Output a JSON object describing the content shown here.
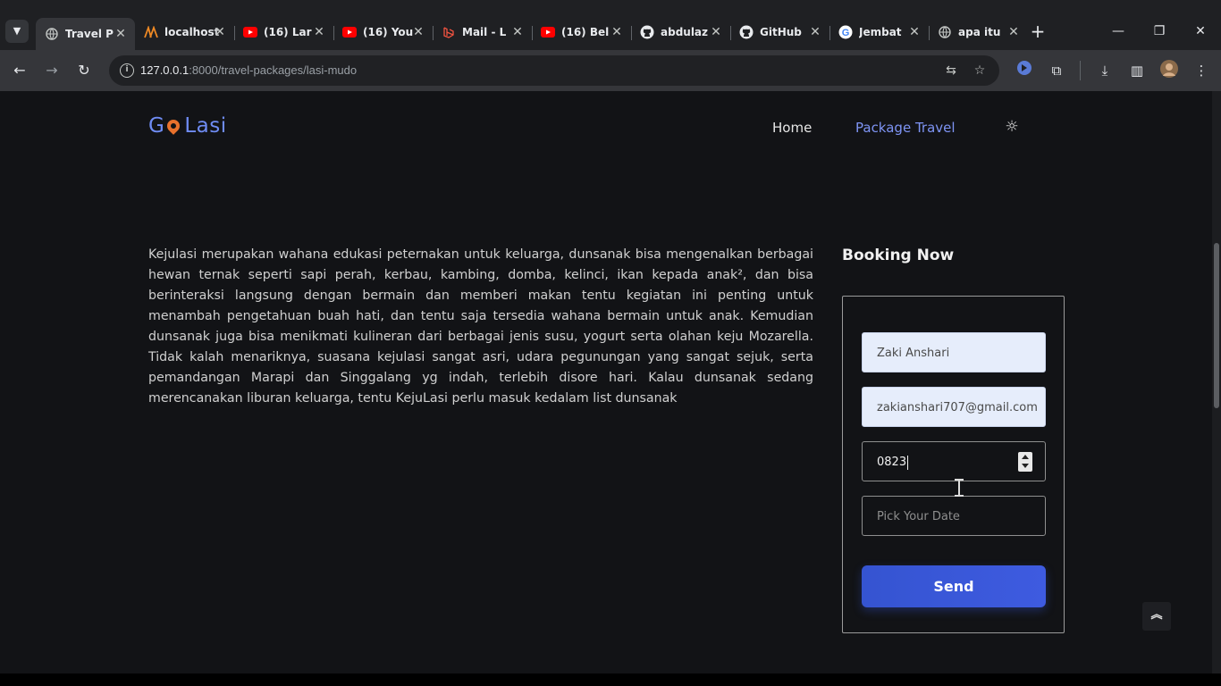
{
  "browser": {
    "tabs": [
      {
        "title": "Travel P",
        "favicon": "globe-icon",
        "active": true
      },
      {
        "title": "localhost",
        "favicon": "xampp-icon"
      },
      {
        "title": "(16) Lar",
        "favicon": "youtube-icon"
      },
      {
        "title": "(16) You",
        "favicon": "youtube-icon"
      },
      {
        "title": "Mail - L",
        "favicon": "laravel-icon"
      },
      {
        "title": "(16) Bel",
        "favicon": "youtube-icon"
      },
      {
        "title": "abdulaz",
        "favicon": "github-icon"
      },
      {
        "title": "GitHub",
        "favicon": "github-icon"
      },
      {
        "title": "Jembat",
        "favicon": "google-icon"
      },
      {
        "title": "apa itu",
        "favicon": "globe-icon"
      }
    ],
    "url_host": "127.0.0.1",
    "url_path": ":8000/travel-packages/lasi-mudo",
    "colors": {
      "accent": "#3554d1",
      "brand": "#6f8cf4",
      "pin": "#e8712c",
      "background": "#121316"
    }
  },
  "site": {
    "logo_prefix": "G",
    "logo_suffix": "Lasi",
    "nav": {
      "home": "Home",
      "package_travel": "Package Travel"
    },
    "description": "Kejulasi merupakan wahana edukasi peternakan untuk keluarga, dunsanak bisa mengenalkan berbagai hewan ternak seperti sapi perah, kerbau, kambing, domba, kelinci, ikan kepada anak², dan bisa berinteraksi langsung dengan bermain dan memberi makan tentu kegiatan ini penting untuk menambah pengetahuan buah hati, dan tentu saja tersedia wahana bermain untuk anak. Kemudian dunsanak juga bisa menikmati kulineran dari berbagai jenis susu, yogurt serta olahan keju Mozarella. Tidak kalah menariknya, suasana kejulasi sangat asri, udara pegunungan yang sangat sejuk, serta pemandangan Marapi dan Singgalang yg indah, terlebih disore hari. Kalau dunsanak sedang merencanakan liburan keluarga, tentu KejuLasi perlu masuk kedalam list dunsanak"
  },
  "booking": {
    "title": "Booking Now",
    "name_value": "Zaki Anshari",
    "email_value": "zakianshari707@gmail.com",
    "phone_value": "0823",
    "date_placeholder": "Pick Your Date",
    "send_label": "Send"
  }
}
